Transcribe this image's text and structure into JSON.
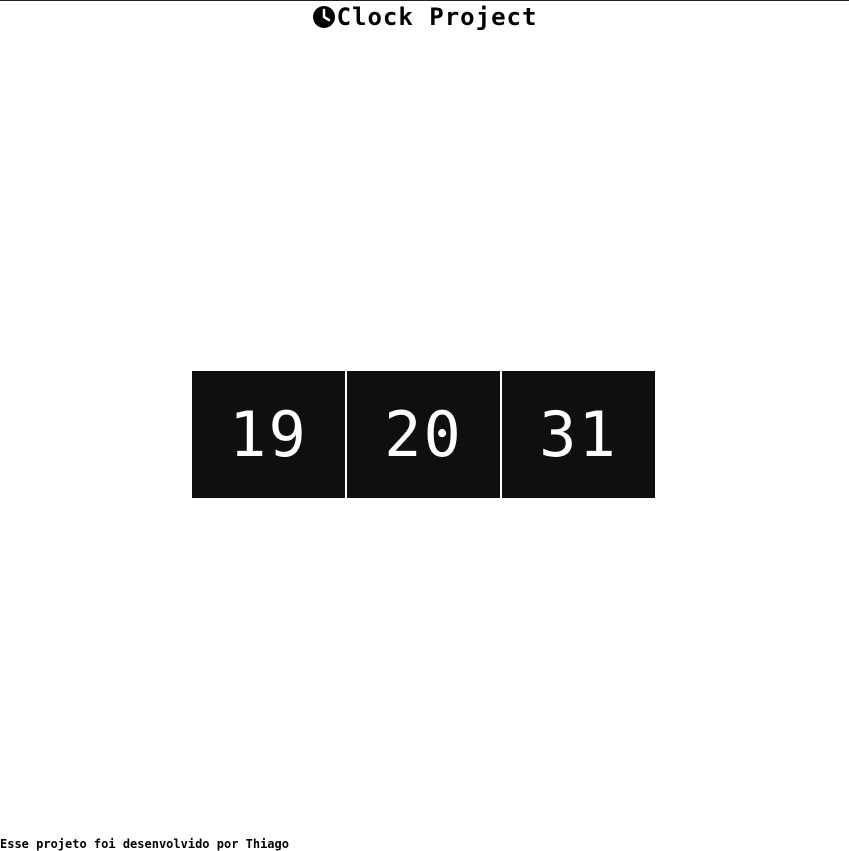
{
  "header": {
    "icon": "clock-icon",
    "title": "Clock Project"
  },
  "clock": {
    "hours": "19",
    "minutes": "20",
    "seconds": "31"
  },
  "footer": {
    "text": "Esse projeto foi desenvolvido por Thiago"
  },
  "colors": {
    "background": "#ffffff",
    "segment_background": "#0f0f0f",
    "segment_text": "#ffffff",
    "text": "#000000"
  }
}
